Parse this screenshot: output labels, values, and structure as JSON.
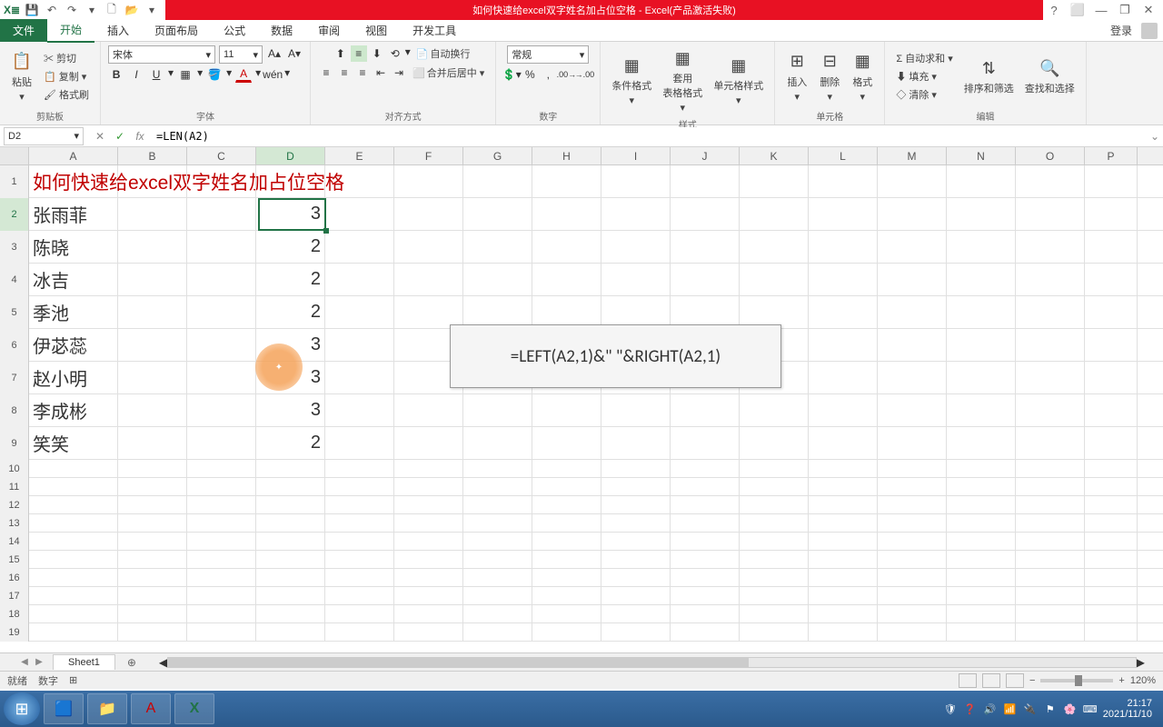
{
  "title": "如何快速给excel双字姓名加占位空格 - Excel(产品激活失败)",
  "qat": {
    "excel": "X≣",
    "save": "💾",
    "undo": "↶",
    "redo": "↷",
    "new": "🗋",
    "open": "📂"
  },
  "win": {
    "help": "?",
    "ribbon_toggle": "⬜",
    "min": "—",
    "restore": "❐",
    "close": "✕"
  },
  "tabs": {
    "file": "文件",
    "home": "开始",
    "insert": "插入",
    "layout": "页面布局",
    "formulas": "公式",
    "data": "数据",
    "review": "审阅",
    "view": "视图",
    "dev": "开发工具",
    "login": "登录"
  },
  "ribbon": {
    "clipboard": {
      "paste": "粘贴",
      "cut": "✂ 剪切",
      "copy": "📋 复制 ▾",
      "painter": "🖌 格式刷",
      "label": "剪贴板"
    },
    "font": {
      "name": "宋体",
      "size": "11",
      "bold": "B",
      "italic": "I",
      "underline": "U",
      "border": "▦",
      "fill": "🪣",
      "color": "A",
      "grow": "A▴",
      "shrink": "A▾",
      "phonetic": "wén",
      "label": "字体"
    },
    "align": {
      "wrap": "自动换行",
      "merge": "合并后居中 ▾",
      "label": "对齐方式"
    },
    "number": {
      "format": "常规",
      "currency": "💲▾",
      "percent": "%",
      "comma": ",",
      "inc": ".00→",
      "dec": "→.00",
      "label": "数字"
    },
    "styles": {
      "cond": "条件格式",
      "table": "套用\n表格格式",
      "cell": "单元格样式",
      "label": "样式"
    },
    "cells": {
      "insert": "插入",
      "delete": "删除",
      "format": "格式",
      "label": "单元格"
    },
    "editing": {
      "sum": "Σ 自动求和 ▾",
      "fill": "⬇ 填充 ▾",
      "clear": "◇ 清除 ▾",
      "sort": "排序和筛选",
      "find": "查找和选择",
      "label": "编辑"
    }
  },
  "namebox": "D2",
  "formula": "=LEN(A2)",
  "fx": {
    "cancel": "✕",
    "confirm": "✓",
    "fx": "fx"
  },
  "columns": [
    "A",
    "B",
    "C",
    "D",
    "E",
    "F",
    "G",
    "H",
    "I",
    "J",
    "K",
    "L",
    "M",
    "N",
    "O",
    "P"
  ],
  "row1_title": "如何快速给excel双字姓名加占位空格",
  "data_rows": [
    {
      "r": 2,
      "a": "张雨菲",
      "d": "3"
    },
    {
      "r": 3,
      "a": "陈晓",
      "d": "2"
    },
    {
      "r": 4,
      "a": "冰吉",
      "d": "2"
    },
    {
      "r": 5,
      "a": "季池",
      "d": "2"
    },
    {
      "r": 6,
      "a": "伊苾蕊",
      "d": "3"
    },
    {
      "r": 7,
      "a": "赵小明",
      "d": "3"
    },
    {
      "r": 8,
      "a": "李成彬",
      "d": "3"
    },
    {
      "r": 9,
      "a": "笑笑",
      "d": "2"
    }
  ],
  "overlay_formula": "=LEFT(A2,1)&\"   \"&RIGHT(A2,1)",
  "sheet": {
    "name": "Sheet1",
    "add": "⊕"
  },
  "status": {
    "ready": "就绪",
    "numlock": "数字",
    "calc": "⊞",
    "zoom": "120%"
  },
  "taskbar": {
    "time": "21:17",
    "date": "2021/11/10"
  }
}
